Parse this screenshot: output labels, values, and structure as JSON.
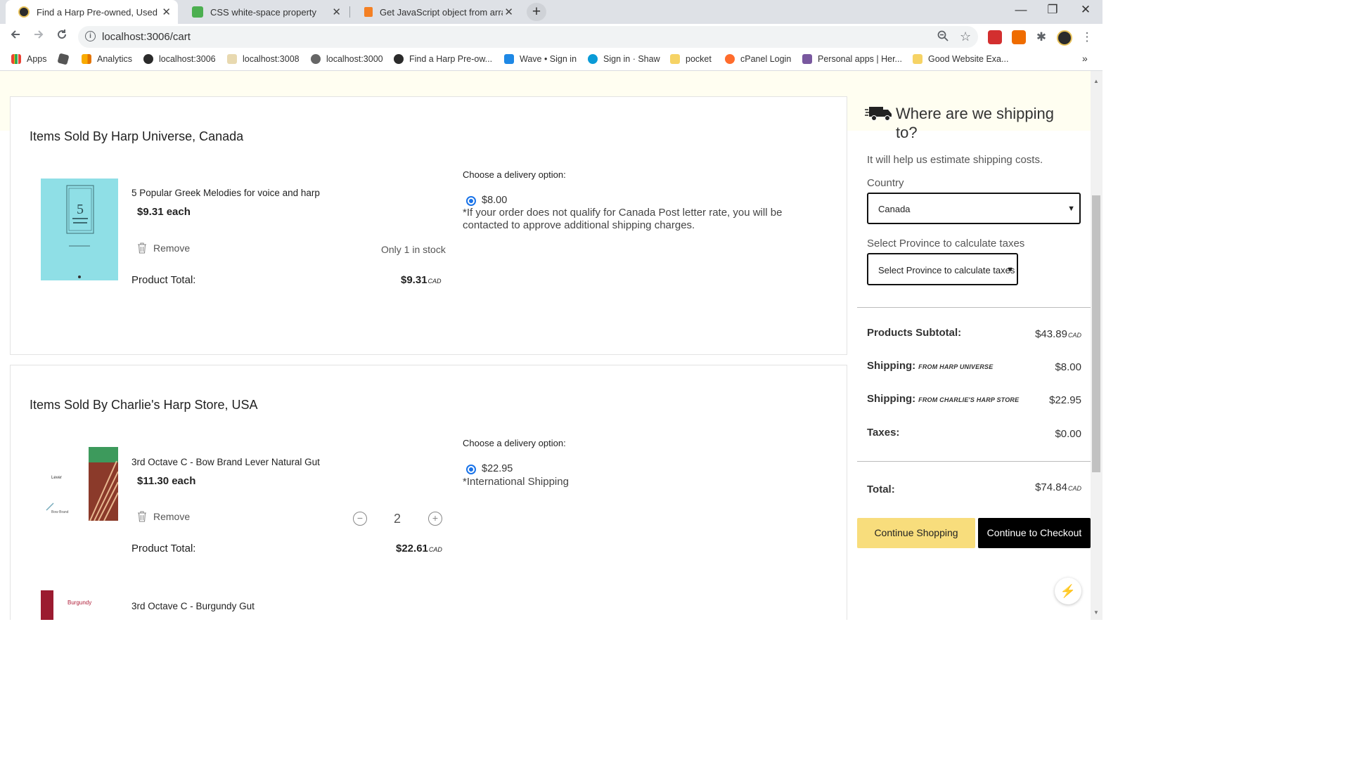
{
  "browser": {
    "tabs": [
      {
        "title": "Find a Harp Pre-owned, Used",
        "close": "✕"
      },
      {
        "title": "CSS white-space property",
        "close": "✕"
      },
      {
        "title": "Get JavaScript object from array",
        "close": "✕"
      }
    ],
    "new_tab": "+",
    "window_controls": {
      "minimize": "—",
      "maximize": "❐",
      "close": "✕"
    },
    "url": "localhost:3006/cart",
    "bookmarks": [
      {
        "label": "Apps"
      },
      {
        "label": ""
      },
      {
        "label": "Analytics"
      },
      {
        "label": "localhost:3006"
      },
      {
        "label": "localhost:3008"
      },
      {
        "label": "localhost:3000"
      },
      {
        "label": "Find a Harp Pre-ow..."
      },
      {
        "label": "Wave • Sign in"
      },
      {
        "label": "Sign in · Shaw"
      },
      {
        "label": "pocket"
      },
      {
        "label": "cPanel Login"
      },
      {
        "label": "Personal apps | Her..."
      },
      {
        "label": "Good Website Exa..."
      }
    ],
    "bookmarks_overflow": "»"
  },
  "sellers": [
    {
      "title": "Items Sold By Harp Universe, Canada",
      "product": {
        "name": "5 Popular Greek Melodies for voice and harp",
        "price_each": "$9.31 each",
        "remove": "Remove",
        "stock": "Only 1 in stock",
        "total_label": "Product Total:",
        "total_value": "$9.31",
        "total_currency": "CAD"
      },
      "delivery": {
        "title": "Choose a delivery option:",
        "price": "$8.00",
        "note": "*If your order does not qualify for Canada Post letter rate, you will be contacted to approve additional shipping charges."
      }
    },
    {
      "title": "Items Sold By Charlie's Harp Store, USA",
      "product": {
        "name": "3rd Octave C - Bow Brand Lever Natural Gut",
        "price_each": "$11.30 each",
        "remove": "Remove",
        "quantity": "2",
        "total_label": "Product Total:",
        "total_value": "$22.61",
        "total_currency": "CAD"
      },
      "delivery": {
        "title": "Choose a delivery option:",
        "price": "$22.95",
        "note": "*International Shipping"
      },
      "next_product": {
        "name": "3rd Octave C - Burgundy Gut"
      }
    }
  ],
  "shipping_panel": {
    "heading": "Where are we shipping to?",
    "subtext": "It will help us estimate shipping costs.",
    "country_label": "Country",
    "country_value": "Canada",
    "province_label": "Select Province to calculate taxes",
    "province_value": "Select Province to calculate taxes"
  },
  "summary": {
    "subtotal_label": "Products Subtotal:",
    "subtotal_value": "$43.89",
    "currency": "CAD",
    "shipping_label": "Shipping:",
    "shipping_1_from": "FROM HARP UNIVERSE",
    "shipping_1_value": "$8.00",
    "shipping_2_from": "FROM CHARLIE'S HARP STORE",
    "shipping_2_value": "$22.95",
    "taxes_label": "Taxes:",
    "taxes_value": "$0.00",
    "total_label": "Total:",
    "total_value": "$74.84"
  },
  "buttons": {
    "continue_shopping": "Continue Shopping",
    "checkout": "Continue to Checkout"
  },
  "icons": {
    "bolt": "⚡"
  }
}
